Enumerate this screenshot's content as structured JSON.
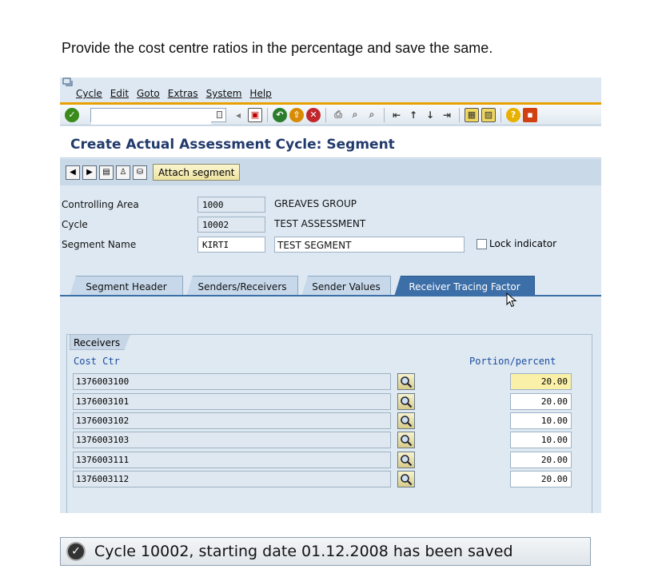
{
  "instruction": "Provide the cost  centre ratios in the percentage and save the same.",
  "menu": {
    "items": [
      "Cycle",
      "Edit",
      "Goto",
      "Extras",
      "System",
      "Help"
    ]
  },
  "toolbar": {
    "command_field_value": "",
    "icons": [
      "enter-icon",
      "back-icon",
      "save-icon",
      "back-nav-icon",
      "exit-icon",
      "cancel-icon",
      "print-icon",
      "find-icon",
      "find-next-icon",
      "first-page-icon",
      "prev-page-icon",
      "next-page-icon",
      "last-page-icon",
      "new-session-icon",
      "shortcut-icon",
      "help-icon",
      "customize-icon"
    ]
  },
  "screen": {
    "title": "Create Actual Assessment Cycle: Segment"
  },
  "app_toolbar": {
    "attach_label": "Attach segment"
  },
  "header_fields": {
    "controlling_area_label": "Controlling Area",
    "controlling_area_value": "1000",
    "controlling_area_desc": "GREAVES GROUP",
    "cycle_label": "Cycle",
    "cycle_value": "10002",
    "cycle_desc": "TEST ASSESSMENT",
    "segment_label": "Segment Name",
    "segment_value": "KIRTI",
    "segment_desc": "TEST SEGMENT",
    "lock_label": "Lock indicator"
  },
  "tabs": [
    {
      "label": "Segment Header",
      "active": false
    },
    {
      "label": "Senders/Receivers",
      "active": false
    },
    {
      "label": "Sender Values",
      "active": false
    },
    {
      "label": "Receiver Tracing Factor",
      "active": true
    }
  ],
  "receivers": {
    "group_title": "Receivers",
    "col_cost_ctr": "Cost Ctr",
    "col_portion": "Portion/percent",
    "rows": [
      {
        "cost_ctr": "1376003100",
        "portion": "20.00"
      },
      {
        "cost_ctr": "1376003101",
        "portion": "20.00"
      },
      {
        "cost_ctr": "1376003102",
        "portion": "10.00"
      },
      {
        "cost_ctr": "1376003103",
        "portion": "10.00"
      },
      {
        "cost_ctr": "1376003111",
        "portion": "20.00"
      },
      {
        "cost_ctr": "1376003112",
        "portion": "20.00"
      }
    ]
  },
  "status": {
    "message": "Cycle 10002, starting date 01.12.2008 has been saved"
  },
  "colors": {
    "title": "#223a6b",
    "active_tab": "#3c6ea8",
    "highlight": "#fbf0a8",
    "menu_accent": "#e8a000"
  }
}
